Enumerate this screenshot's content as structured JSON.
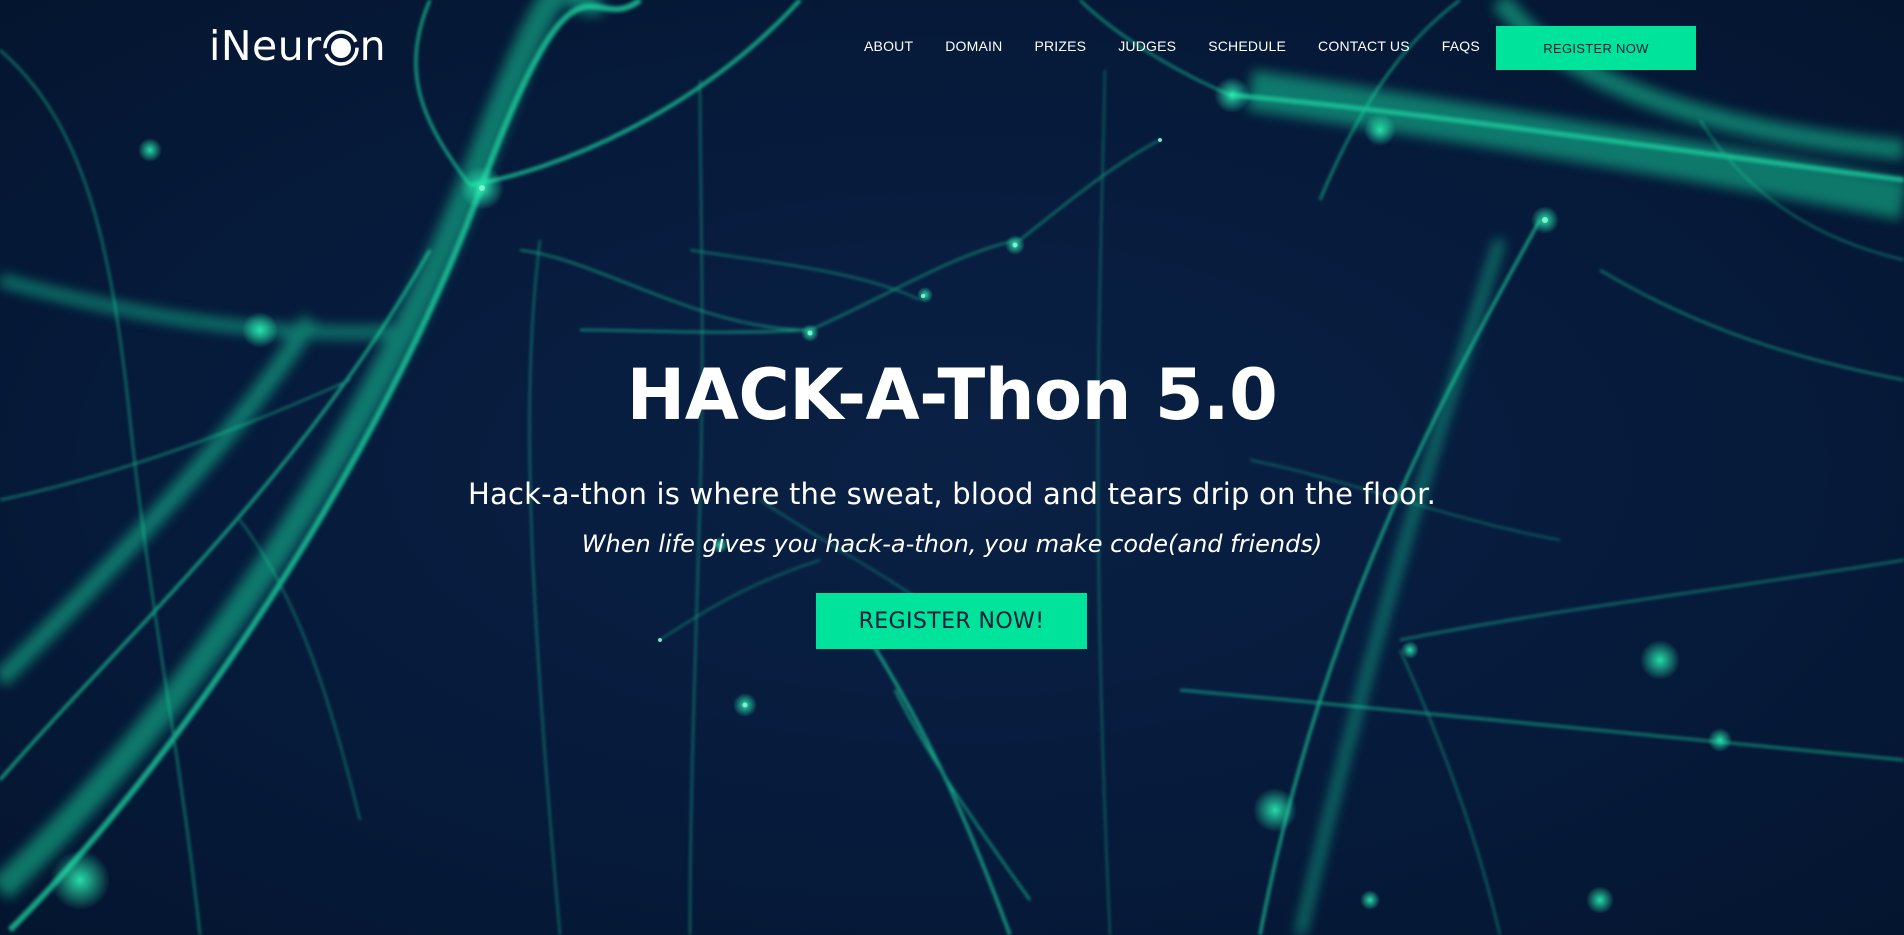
{
  "brand": {
    "logo_part_a": "iNeur",
    "logo_part_b": "n",
    "logo_icon": "ring-o-icon"
  },
  "nav": {
    "items": [
      {
        "label": "ABOUT"
      },
      {
        "label": "DOMAIN"
      },
      {
        "label": "PRIZES"
      },
      {
        "label": "JUDGES"
      },
      {
        "label": "SCHEDULE"
      },
      {
        "label": "CONTACT US"
      },
      {
        "label": "FAQS"
      }
    ],
    "register_label": "REGISTER NOW"
  },
  "hero": {
    "title": "HACK-A-Thon 5.0",
    "subtitle": "Hack-a-thon is where the sweat, blood and tears drip on the floor.",
    "tagline": "When life gives you hack-a-thon, you make code(and friends)",
    "register_label": "REGISTER NOW!"
  },
  "colors": {
    "background": "#061a3a",
    "accent": "#00e39a",
    "network": "#1fd3a0",
    "text": "#ffffff"
  },
  "background_image": "neural-network-lines"
}
